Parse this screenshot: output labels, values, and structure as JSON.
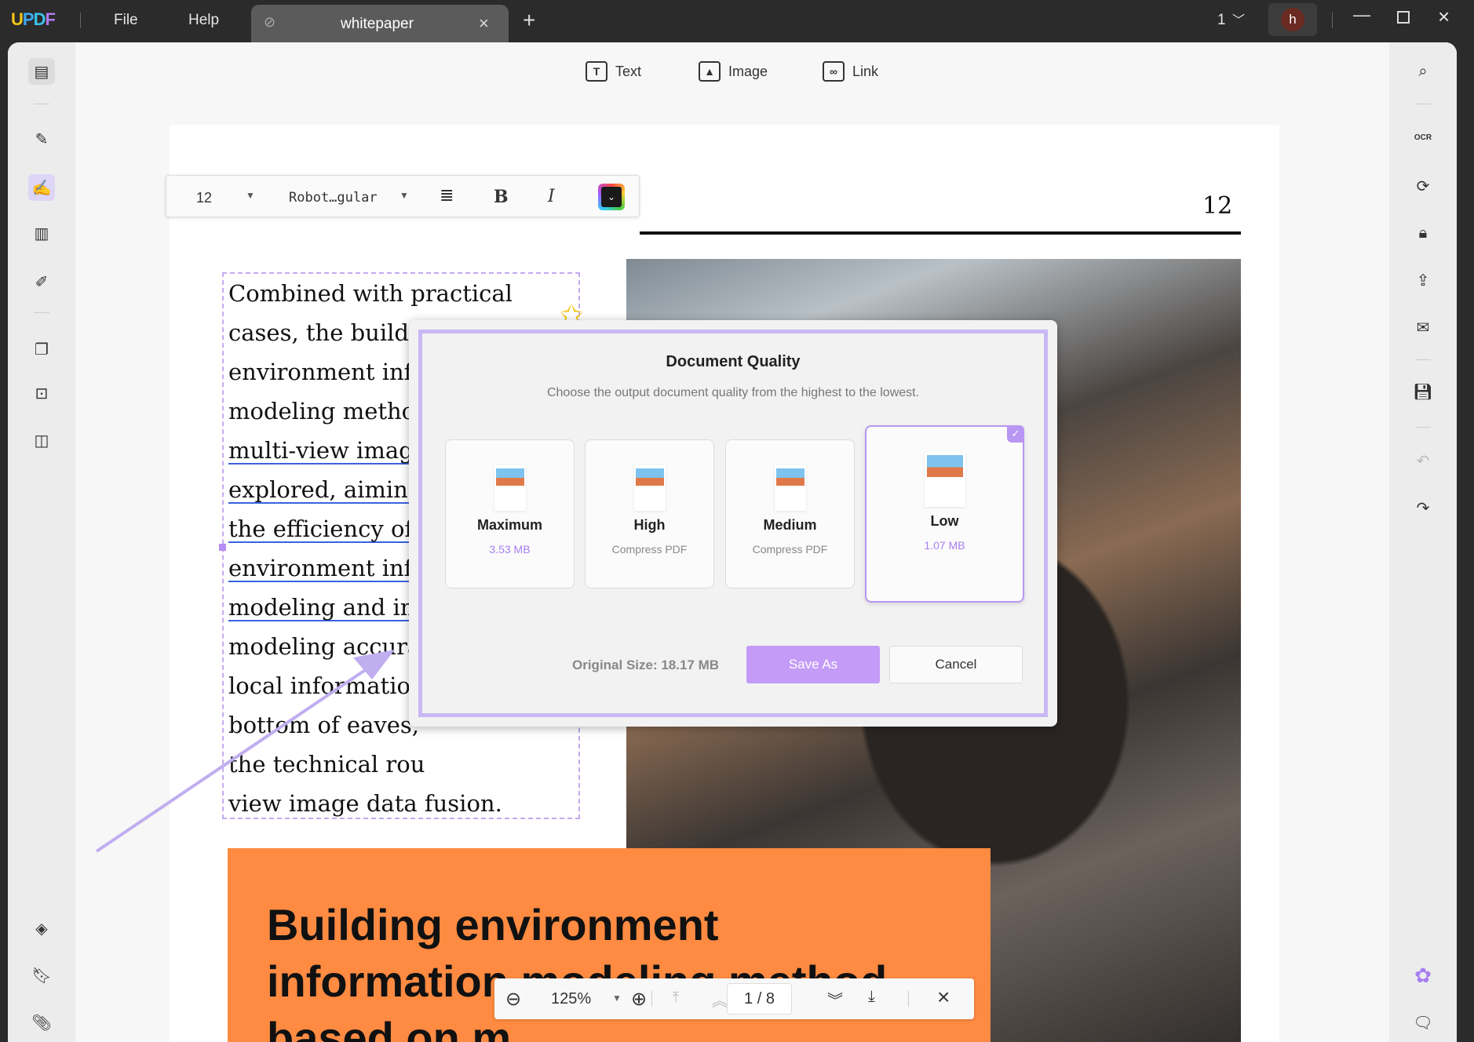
{
  "app": {
    "logo": "UPDF",
    "menu": [
      "File",
      "Help"
    ],
    "tab_title": "whitepaper",
    "page_indicator": "1",
    "avatar": "h"
  },
  "toolbar": {
    "text": "Text",
    "image": "Image",
    "link": "Link"
  },
  "format_bar": {
    "font_size": "12",
    "font_name": "Robot…gular",
    "bold": "B",
    "italic": "I",
    "color": "#1a1a1a"
  },
  "document": {
    "page_number": "12",
    "body_lines": [
      {
        "text": "Combined with practical",
        "link": false
      },
      {
        "text": "cases, the building",
        "link": false
      },
      {
        "text": "environment inf",
        "link": false
      },
      {
        "text": "modeling metho",
        "link": false
      },
      {
        "text": "multi-view imag",
        "link": true
      },
      {
        "text": "explored, aiming",
        "link": true
      },
      {
        "text": "the efficiency of",
        "link": true
      },
      {
        "text": "environment inf",
        "link": true
      },
      {
        "text": "modeling and im",
        "link": true
      },
      {
        "text": "modeling accura",
        "link": false
      },
      {
        "text": "local information",
        "link": false
      },
      {
        "text": "bottom of eaves,",
        "link": false
      },
      {
        "text": "the technical rou",
        "link": false
      },
      {
        "text": "view image data fusion.",
        "link": false
      }
    ],
    "banner_lines": [
      "Building environment",
      "information modeling method",
      "based on m"
    ],
    "banner_color": "#ff8b42"
  },
  "dialog": {
    "title": "Document Quality",
    "subtitle": "Choose the output document quality from the highest to the lowest.",
    "options": [
      {
        "name": "Maximum",
        "detail": "3.53 MB",
        "selected": false
      },
      {
        "name": "High",
        "detail": "Compress PDF",
        "selected": false
      },
      {
        "name": "Medium",
        "detail": "Compress PDF",
        "selected": false
      },
      {
        "name": "Low",
        "detail": "1.07 MB",
        "selected": true
      }
    ],
    "original_size": "Original Size: 18.17 MB",
    "save_as": "Save As",
    "cancel": "Cancel",
    "accent": "#c49bf7"
  },
  "nav": {
    "zoom": "125%",
    "page": "1 / 8"
  }
}
